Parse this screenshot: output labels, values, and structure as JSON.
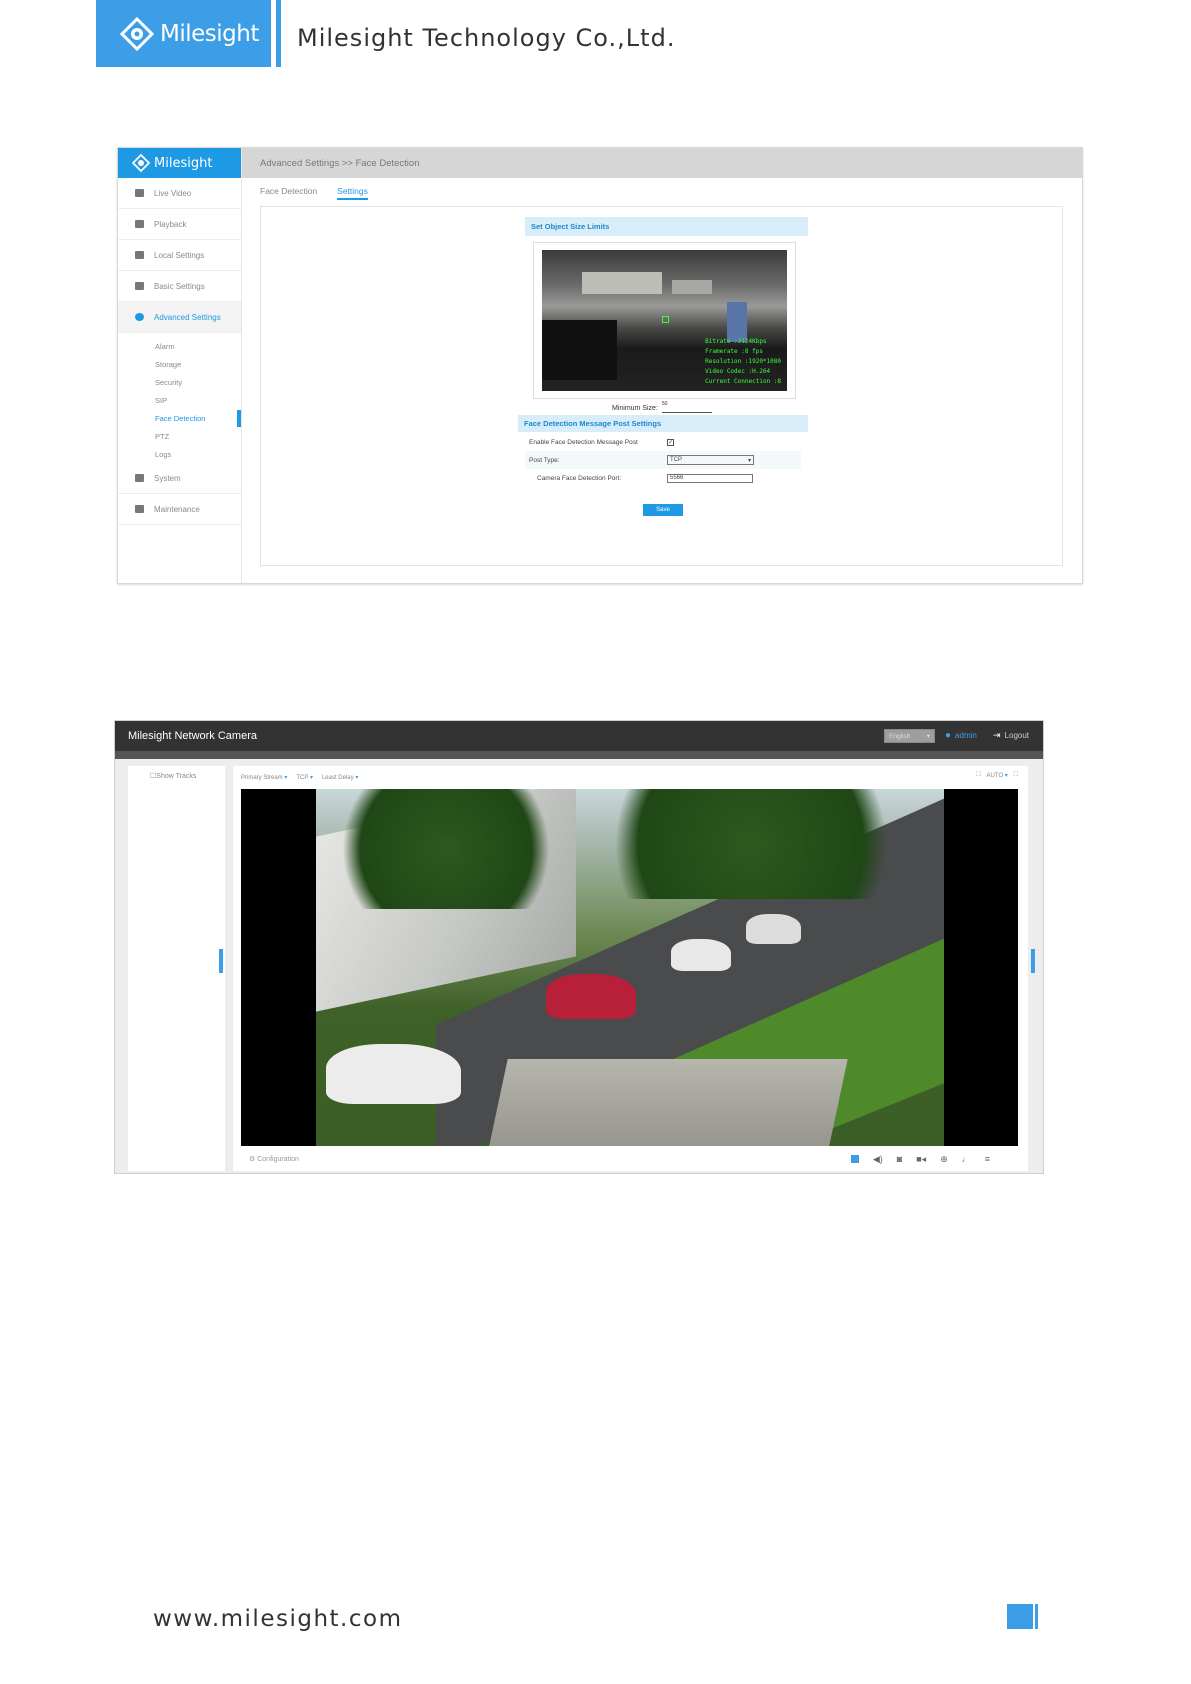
{
  "header": {
    "logo_text": "Milesight",
    "company": "Milesight Technology Co.,Ltd."
  },
  "shot1": {
    "brand": "Milesight",
    "breadcrumb": "Advanced Settings >> Face Detection",
    "nav": [
      {
        "label": "Live Video"
      },
      {
        "label": "Playback"
      },
      {
        "label": "Local Settings"
      },
      {
        "label": "Basic Settings"
      },
      {
        "label": "Advanced Settings"
      }
    ],
    "subnav": [
      {
        "label": "Alarm"
      },
      {
        "label": "Storage"
      },
      {
        "label": "Security"
      },
      {
        "label": "SIP"
      },
      {
        "label": "Face Detection"
      },
      {
        "label": "PTZ"
      },
      {
        "label": "Logs"
      }
    ],
    "nav_after": [
      {
        "label": "System"
      },
      {
        "label": "Maintenance"
      }
    ],
    "tabs": {
      "tab1": "Face Detection",
      "tab2": "Settings"
    },
    "section1": "Set Object Size Limits",
    "osd": {
      "l1": "Bitrate :3124Kbps",
      "l2": "Framerate :8 fps",
      "l3": "Resolution :1920*1080",
      "l4": "Video Codec :H.264",
      "l5": "Current Connection :8"
    },
    "min_size_label": "Minimum Size:",
    "min_size_value": "50",
    "section2": "Face Detection Message Post Settings",
    "row1_label": "Enable Face Detection Message Post",
    "row1_check": "✓",
    "row2_label": "Post Type:",
    "row2_value": "TCP",
    "row3_label": "Camera Face Detection Port:",
    "row3_value": "5566",
    "save": "Save"
  },
  "shot2": {
    "title": "Milesight Network Camera",
    "lang": "English",
    "user": "admin",
    "logout": "Logout",
    "show_tracks": "Show Tracks",
    "stream": "Primary Stream",
    "protocol": "TCP",
    "delay": "Least Delay",
    "auto": "AUTO",
    "configuration": "Configuration"
  },
  "footer": {
    "url": "www.milesight.com"
  }
}
